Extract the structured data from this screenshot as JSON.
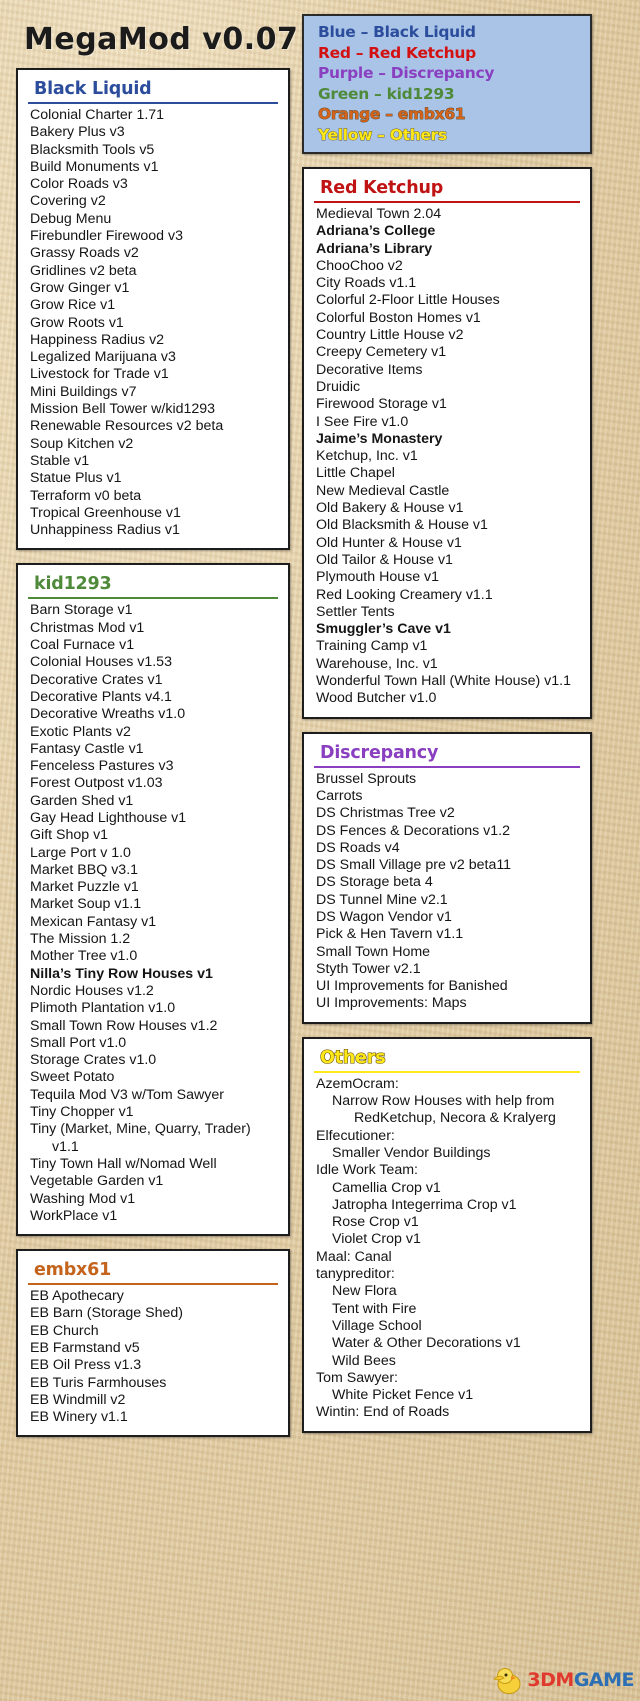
{
  "title": "MegaMod v0.07",
  "legend": {
    "name": "color-legend",
    "background": "#aac4e8",
    "lines": [
      {
        "text": "Blue – Black Liquid",
        "color": "#2c4d9c"
      },
      {
        "text": "Red – Red Ketchup",
        "color": "#d41111"
      },
      {
        "text": "Purple – Discrepancy",
        "color": "#8a3fc0"
      },
      {
        "text": "Green – kid1293",
        "color": "#4f8a3a"
      },
      {
        "text": "Orange – embx61",
        "color": "#d4641c"
      },
      {
        "text": "Yellow – Others",
        "color": "#ffe817"
      }
    ]
  },
  "sections": {
    "black_liquid": {
      "heading": "Black Liquid",
      "color": "#2c4d9c",
      "items": [
        "Colonial Charter 1.71",
        "Bakery Plus v3",
        "Blacksmith Tools v5",
        "Build Monuments v1",
        "Color Roads v3",
        "Covering v2",
        "Debug Menu",
        "Firebundler Firewood v3",
        "Grassy Roads v2",
        "Gridlines v2 beta",
        "Grow Ginger v1",
        "Grow Rice v1",
        "Grow Roots v1",
        "Happiness Radius v2",
        "Legalized Marijuana v3",
        "Livestock for Trade v1",
        "Mini Buildings v7",
        "Mission Bell Tower w/kid1293",
        "Renewable Resources v2 beta",
        "Soup Kitchen v2",
        "Stable v1",
        "Statue Plus v1",
        "Terraform v0 beta",
        "Tropical Greenhouse v1",
        "Unhappiness Radius v1"
      ]
    },
    "kid1293": {
      "heading": "kid1293",
      "color": "#4f8a3a",
      "items": [
        "Barn Storage v1",
        "Christmas Mod v1",
        "Coal Furnace v1",
        "Colonial Houses v1.53",
        "Decorative Crates v1",
        "Decorative Plants v4.1",
        "Decorative Wreaths v1.0",
        "Exotic Plants v2",
        "Fantasy Castle v1",
        "Fenceless Pastures v3",
        "Forest Outpost v1.03",
        "Garden Shed v1",
        "Gay Head Lighthouse v1",
        "Gift Shop v1",
        "Large Port v 1.0",
        "Market BBQ v3.1",
        "Market Puzzle v1",
        "Market Soup v1.1",
        "Mexican Fantasy v1",
        "The Mission 1.2",
        "Mother Tree v1.0",
        "Nilla’s Tiny Row Houses v1",
        "Nordic Houses v1.2",
        "Plimoth Plantation v1.0",
        "Small Town Row Houses v1.2",
        "Small Port v1.0",
        "Storage Crates v1.0",
        "Sweet Potato",
        "Tequila Mod V3 w/Tom Sawyer",
        "Tiny Chopper v1",
        "Tiny (Market, Mine, Quarry, Trader) v1.1",
        "Tiny Town Hall w/Nomad Well",
        "Vegetable Garden v1",
        "Washing Mod v1",
        "WorkPlace v1"
      ],
      "bold_items": [
        "Nilla’s Tiny Row Houses v1"
      ]
    },
    "embx61": {
      "heading": "embx61",
      "color": "#c4641c",
      "items": [
        "EB Apothecary",
        "EB Barn (Storage Shed)",
        "EB Church",
        "EB Farmstand v5",
        "EB Oil Press v1.3",
        "EB Turis Farmhouses",
        "EB Windmill v2",
        "EB Winery v1.1"
      ]
    },
    "red_ketchup": {
      "heading": "Red Ketchup",
      "color": "#c01414",
      "items": [
        "Medieval Town 2.04",
        "Adriana’s College",
        "Adriana’s Library",
        "ChooChoo v2",
        "City Roads v1.1",
        "Colorful 2-Floor Little Houses",
        "Colorful Boston Homes v1",
        "Country Little House v2",
        "Creepy Cemetery v1",
        "Decorative Items",
        "Druidic",
        "Firewood Storage v1",
        "I See Fire v1.0",
        "Jaime’s Monastery",
        "Ketchup, Inc. v1",
        "Little Chapel",
        "New Medieval Castle",
        "Old Bakery & House v1",
        "Old Blacksmith & House v1",
        "Old Hunter & House v1",
        "Old Tailor & House v1",
        "Plymouth House v1",
        "Red Looking Creamery v1.1",
        "Settler Tents",
        "Smuggler’s Cave v1",
        "Training Camp v1",
        "Warehouse, Inc. v1",
        "Wonderful Town Hall (White House) v1.1",
        "Wood Butcher v1.0"
      ],
      "bold_items": [
        "Adriana’s College",
        "Adriana’s Library",
        "Jaime’s Monastery",
        "Smuggler’s Cave v1"
      ]
    },
    "discrepancy": {
      "heading": "Discrepancy",
      "color": "#8a3fc0",
      "items": [
        "Brussel Sprouts",
        "Carrots",
        "DS Christmas Tree v2",
        "DS Fences & Decorations v1.2",
        "DS Roads v4",
        "DS Small Village pre v2 beta11",
        "DS Storage beta 4",
        "DS Tunnel Mine v2.1",
        "DS Wagon Vendor v1",
        "Pick & Hen Tavern v1.1",
        "Small Town Home",
        "Styth Tower v2.1",
        "UI Improvements for Banished",
        "UI Improvements: Maps"
      ]
    },
    "others": {
      "heading": "Others",
      "color": "#ffe817",
      "entries": [
        {
          "text": "AzemOcram:",
          "indent": 0
        },
        {
          "text": "Narrow Row Houses with help from RedKetchup, Necora & Kralyerg",
          "indent": 1
        },
        {
          "text": "Elfecutioner:",
          "indent": 0
        },
        {
          "text": "Smaller Vendor Buildings",
          "indent": 1
        },
        {
          "text": "Idle Work Team:",
          "indent": 0
        },
        {
          "text": "Camellia Crop v1",
          "indent": 1
        },
        {
          "text": "Jatropha Integerrima Crop v1",
          "indent": 1
        },
        {
          "text": "Rose Crop v1",
          "indent": 1
        },
        {
          "text": "Violet Crop v1",
          "indent": 1
        },
        {
          "text": "Maal:  Canal",
          "indent": 0
        },
        {
          "text": "tanypreditor:",
          "indent": 0
        },
        {
          "text": "New Flora",
          "indent": 1
        },
        {
          "text": "Tent with Fire",
          "indent": 1
        },
        {
          "text": "Village School",
          "indent": 1
        },
        {
          "text": "Water & Other Decorations v1",
          "indent": 1
        },
        {
          "text": "Wild Bees",
          "indent": 1
        },
        {
          "text": "Tom Sawyer:",
          "indent": 0
        },
        {
          "text": "White Picket Fence v1",
          "indent": 1
        },
        {
          "text": "Wintin:  End of Roads",
          "indent": 0
        }
      ]
    }
  },
  "watermark": {
    "text_a": "3DM",
    "text_b": "GAME",
    "color_a": "#e03a2f",
    "color_b": "#2c6fb5"
  }
}
